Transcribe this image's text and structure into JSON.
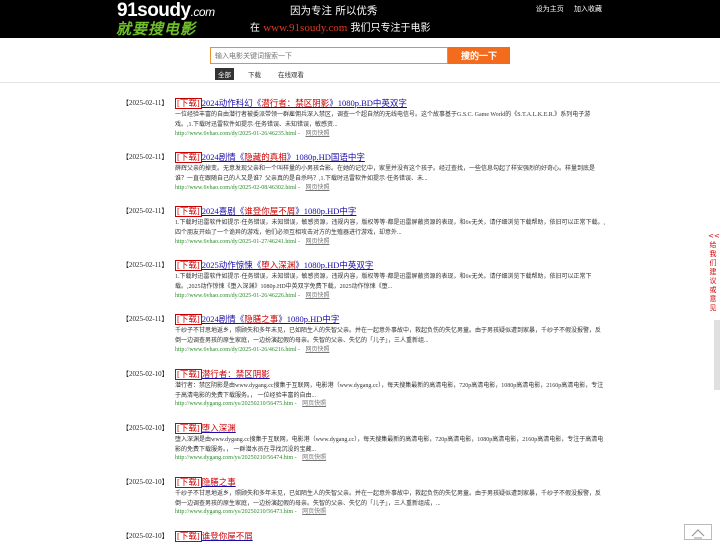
{
  "header": {
    "logo_en": "91soudy",
    "logo_dotcom": ".com",
    "logo_cn": "就要搜电影",
    "slogan1": "因为专注  所以优秀",
    "slogan2_pre": "在",
    "slogan2_site": "www.91soudy.com",
    "slogan2_post": "我们只专注于电影",
    "link_home": "设为主页",
    "link_fav": "加入收藏"
  },
  "search": {
    "placeholder": "输入电影关键词搜索一下",
    "button": "搜的一下"
  },
  "filters": [
    "全部",
    "下载",
    "在线观看"
  ],
  "results": [
    {
      "date": "【2025-02-11】",
      "tag": "下载",
      "title_pre": "2024动作科幻《",
      "title_hl": "潜行者：禁区阴影",
      "title_post": "》1080p.BD中英双字",
      "desc": "一位经验丰富的自由潜行者被委派带领一群雇佣兵深入禁区，调查一个超自然的无线电信号。这个故事基于G.S.C. Game World的《S.T.A.L.K.E.R.》系列电子游戏。,1.下载时迅雷软件如提示·任务错误、未知错误，敏感资...",
      "url": "http://www.6vhao.com/dy/2025-01-26/46235.html",
      "snap": "网页快照"
    },
    {
      "date": "【2025-02-11】",
      "tag": "下载",
      "title_pre": "2024剧情《",
      "title_hl": "隐藏的真相",
      "title_post": "》1080p.HD国语中字",
      "desc": "薛辉父亲的掉变。无意发现父亲和一个叫样量的小男孩合影。在她的记忆中，家里并没有这个孩子。经过查找，一些信息勾起了样安强烈的好奇心。样量到底是谁？一直在跟随自己的人又是谁？父亲真的是自杀吗？,1.下载时迅雷软件如提示·任务错误、未...",
      "url": "http://www.6vhao.com/dy/2025-02-08/46302.html",
      "snap": "网页快照"
    },
    {
      "date": "【2025-02-11】",
      "tag": "下载",
      "title_pre": "2024喜剧《",
      "title_hl": "谁登你屋不屑",
      "title_post": "》1080p.HD中字",
      "desc": "1.下载时迅雷软件如提示·任务错误，未知错误，敏感资源，违规内容，版权等等·都是迅雷屏蔽资源的表现，和6v无关，请仔细浏览下载帮助，依旧可以正常下载。,         四个朋友开始了一个诡异的游戏，他们必须互相攻击对方的生殖器进行游戏，却意外...",
      "url": "http://www.6vhao.com/dy/2025-01-27/46241.html",
      "snap": "网页快照"
    },
    {
      "date": "【2025-02-11】",
      "tag": "下载",
      "title_pre": "2025动作惊悚《",
      "title_hl": "堕入深渊",
      "title_post": "》1080p.HD中英双字",
      "desc": "1.下载时迅雷软件如提示·任务错误，未知错误，敏感资源，违规内容，版权等等·都是迅雷屏蔽资源的表现，和6v无关。请仔细浏览下载帮助，依旧可以正常下载。,2025动作惊悚《堕入深渊》1080p.HD中英双字免费下载，2025动作惊悚《堕...",
      "url": "http://www.6vhao.com/dy/2025-01-26/46226.html",
      "snap": "网页快照"
    },
    {
      "date": "【2025-02-11】",
      "tag": "下载",
      "title_pre": "2024剧情《",
      "title_hl": "隐膳之事",
      "title_post": "》1080p.HD中字",
      "desc": "千纱子不甘思地返乡，照顾失和多年未见，已如陌生人的失智父亲。并在一起意外事故中，救起负伤的失忆男童。由于男孩疑似遭到家暴，千纱子不假没报警，反倒一边调查男孩的原生家庭，一边扮演起假的母亲。失智的父亲、失忆的「儿子」，三人重新组...",
      "url": "http://www.6vhao.com/dy/2025-01-26/46216.html",
      "snap": "网页快照"
    },
    {
      "date": "【2025-02-10】",
      "tag": "下载",
      "title_pre": "",
      "title_hl": "潜行者：禁区阴影",
      "title_post": "",
      "desc": "潜行者：禁区阴影是由www.dygang.cc搜集于互联网，电影港（www.dygang.cc），每天搜集最新的高清电影，720p高清电影，1080p高清电影，2160p高清电影，专注于高清电影的免费下载服务。，       一位经验丰富的自由...",
      "url": "http://www.dygang.com/ys/20250210/56475.htm",
      "snap": "网页快照"
    },
    {
      "date": "【2025-02-10】",
      "tag": "下载",
      "title_pre": "",
      "title_hl": "堕入深渊",
      "title_post": "",
      "desc": "堕入深渊是由www.dygang.cc搜集于互联网，电影港（www.dygang.cc），每天搜集最新的高清电影，720p高清电影，1080p高清电影，2160p高清电影，专注于高清电影的免费下载服务。，       一群潜水员在寻找沉没的宝藏...",
      "url": "http://www.dygang.com/ys/20250210/56474.htm",
      "snap": "网页快照"
    },
    {
      "date": "【2025-02-10】",
      "tag": "下载",
      "title_pre": "",
      "title_hl": "隐膳之事",
      "title_post": "",
      "desc": "千纱子不甘思地返乡，照顾失和多年未见，已如陌生人的失智父亲。并在一起意外事故中，救起负伤的失忆男童。由于男孩疑似遭到家暴，千纱子不假没报警，反倒一边调查男孩的原生家庭，一边扮演起假的母亲。失智的父亲、失忆的「儿子」，三人重新组成，...",
      "url": "http://www.dygang.com/ys/20250210/56473.htm",
      "snap": "网页快照"
    },
    {
      "date": "【2025-02-10】",
      "tag": "下载",
      "title_pre": "",
      "title_hl": "谁登你屋不屑",
      "title_post": "",
      "desc": "",
      "url": "",
      "snap": ""
    }
  ],
  "side_share": "<<\n给\n我\n们\n建\n议\n或\n意\n见"
}
